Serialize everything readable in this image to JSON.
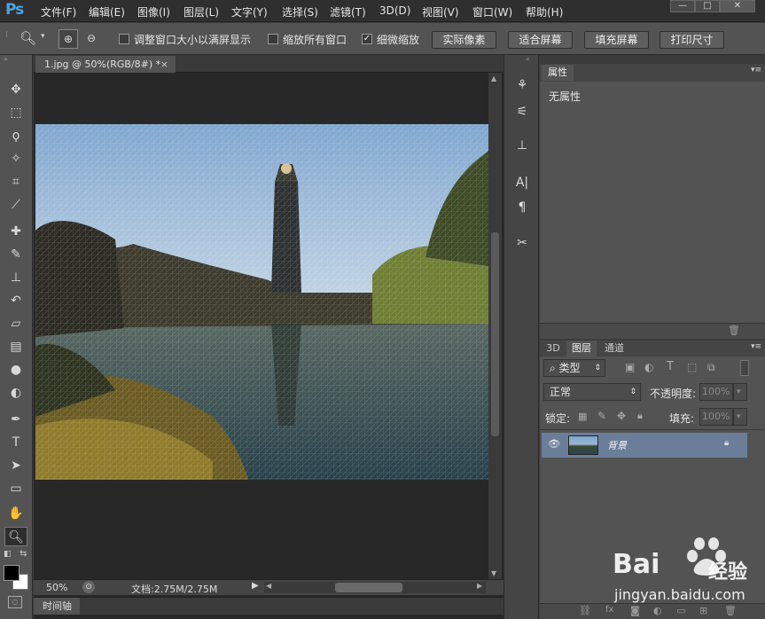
{
  "app": {
    "logo": "Ps"
  },
  "menu": [
    "文件(F)",
    "编辑(E)",
    "图像(I)",
    "图层(L)",
    "文字(Y)",
    "选择(S)",
    "滤镜(T)",
    "3D(D)",
    "视图(V)",
    "窗口(W)",
    "帮助(H)"
  ],
  "window_controls": {
    "min": "—",
    "max": "□",
    "close": "✕"
  },
  "options": {
    "resize_label": "调整窗口大小以满屏显示",
    "zoom_all_label": "缩放所有窗口",
    "scrubby_label": "细微缩放",
    "btn_actual": "实际像素",
    "btn_fit": "适合屏幕",
    "btn_fill": "填充屏幕",
    "btn_print": "打印尺寸"
  },
  "document": {
    "tab_title": "1.jpg @ 50%(RGB/8#) *",
    "close": "×"
  },
  "status": {
    "zoom": "50%",
    "doc_info": "文档:2.75M/2.75M"
  },
  "timeline": {
    "label": "时间轴"
  },
  "properties": {
    "tab": "属性",
    "empty_text": "无属性"
  },
  "layers_panel": {
    "tabs": [
      "3D",
      "图层",
      "通道"
    ],
    "filter_kind": "类型",
    "blend_mode": "正常",
    "opacity_label": "不透明度:",
    "opacity_value": "100%",
    "lock_label": "锁定:",
    "fill_label": "填充:",
    "fill_value": "100%",
    "layer_name": "背景"
  },
  "watermark": {
    "brand": "Bai",
    "brand2": "经验",
    "url": "jingyan.baidu.com"
  }
}
